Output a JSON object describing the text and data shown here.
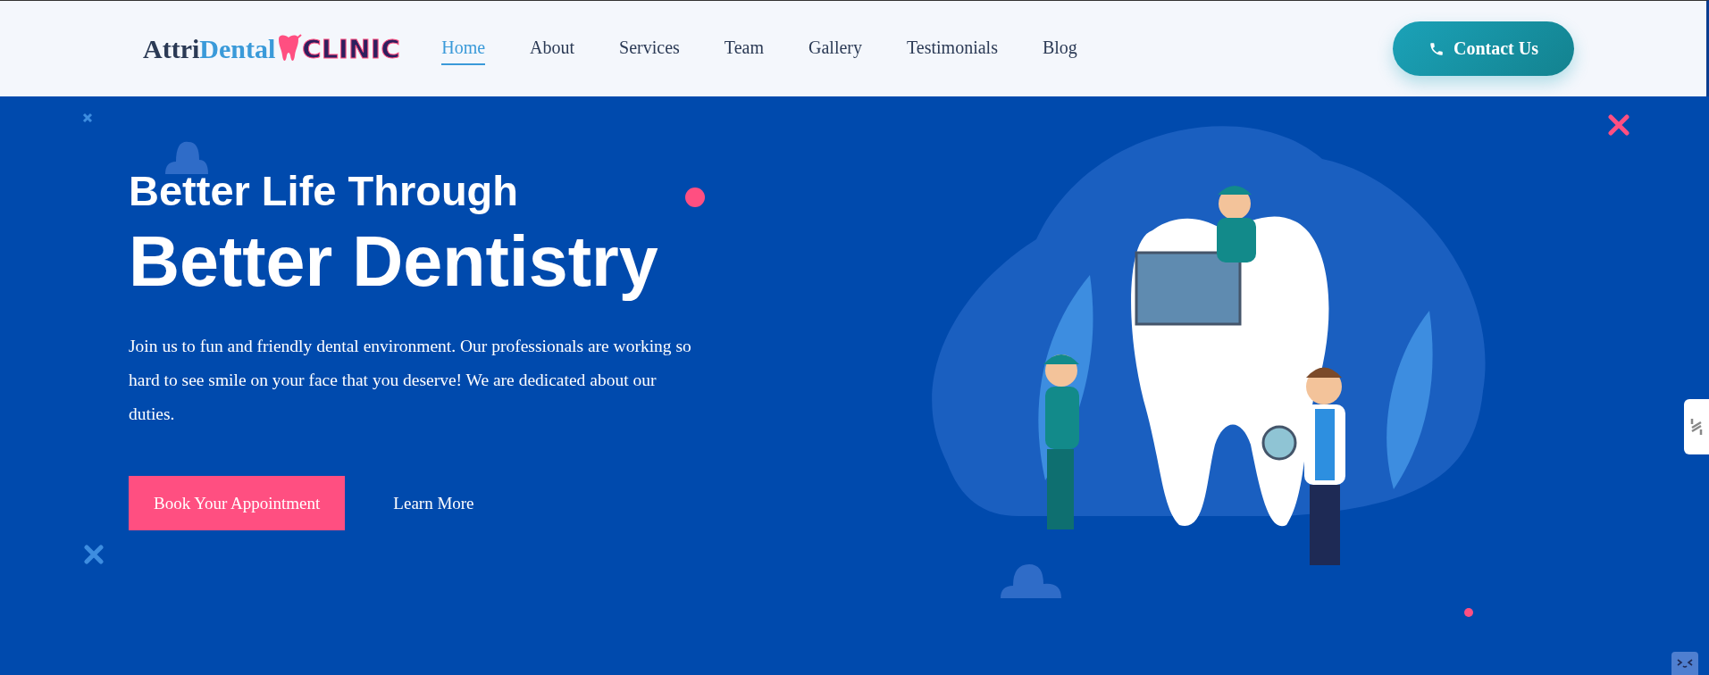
{
  "header": {
    "logo": {
      "first": "Attri",
      "second": "Dental",
      "third": "CLINIC"
    },
    "nav": [
      {
        "label": "Home",
        "selected": true
      },
      {
        "label": "About",
        "selected": false
      },
      {
        "label": "Services",
        "selected": false
      },
      {
        "label": "Team",
        "selected": false
      },
      {
        "label": "Gallery",
        "selected": false
      },
      {
        "label": "Testimonials",
        "selected": false
      },
      {
        "label": "Blog",
        "selected": false
      }
    ],
    "contact_button": "Contact Us"
  },
  "hero": {
    "title_line1": "Better Life Through",
    "title_line2": "Better Dentistry",
    "text": "Join us to fun and friendly dental environment. Our professionals are working so hard to see smile on your face that you deserve! We are dedicated about our duties.",
    "primary_button": "Book Your Appointment",
    "secondary_button": "Learn More"
  }
}
